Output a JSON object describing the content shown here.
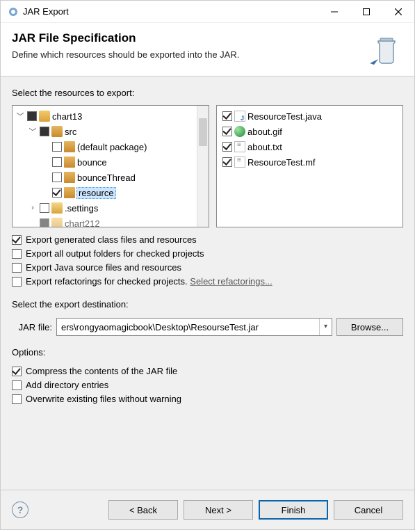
{
  "window": {
    "title": "JAR Export"
  },
  "banner": {
    "heading": "JAR File Specification",
    "desc": "Define which resources should be exported into the JAR."
  },
  "labels": {
    "select_resources": "Select the resources to export:",
    "select_dest": "Select the export destination:",
    "jar_file": "JAR file:",
    "browse": "Browse...",
    "options": "Options:"
  },
  "tree": {
    "root": "chart13",
    "src": "src",
    "pkg_default": "(default package)",
    "pkg_bounce": "bounce",
    "pkg_bounceThread": "bounceThread",
    "pkg_resource": "resource",
    "settings": ".settings",
    "chart212_prefix": "chart212"
  },
  "files": [
    {
      "name": "ResourceTest.java",
      "kind": "java",
      "checked": true
    },
    {
      "name": "about.gif",
      "kind": "gif",
      "checked": true
    },
    {
      "name": "about.txt",
      "kind": "txt",
      "checked": true
    },
    {
      "name": "ResourceTest.mf",
      "kind": "mf",
      "checked": true
    }
  ],
  "export_opts": {
    "generated_class": {
      "checked": true,
      "label": "Export generated class files and resources"
    },
    "all_outputs": {
      "checked": false,
      "label": "Export all output folders for checked projects"
    },
    "java_source": {
      "checked": false,
      "label": "Export Java source files and resources"
    },
    "refactorings": {
      "checked": false,
      "label": "Export refactorings for checked projects. ",
      "link": "Select refactorings..."
    }
  },
  "destination": {
    "value": "ers\\rongyaomagicbook\\Desktop\\ResourseTest.jar"
  },
  "options_block": {
    "compress": {
      "checked": true,
      "label": "Compress the contents of the JAR file"
    },
    "add_dirs": {
      "checked": false,
      "label": "Add directory entries"
    },
    "overwrite": {
      "checked": false,
      "label": "Overwrite existing files without warning"
    }
  },
  "buttons": {
    "back": "< Back",
    "next": "Next >",
    "finish": "Finish",
    "cancel": "Cancel"
  }
}
